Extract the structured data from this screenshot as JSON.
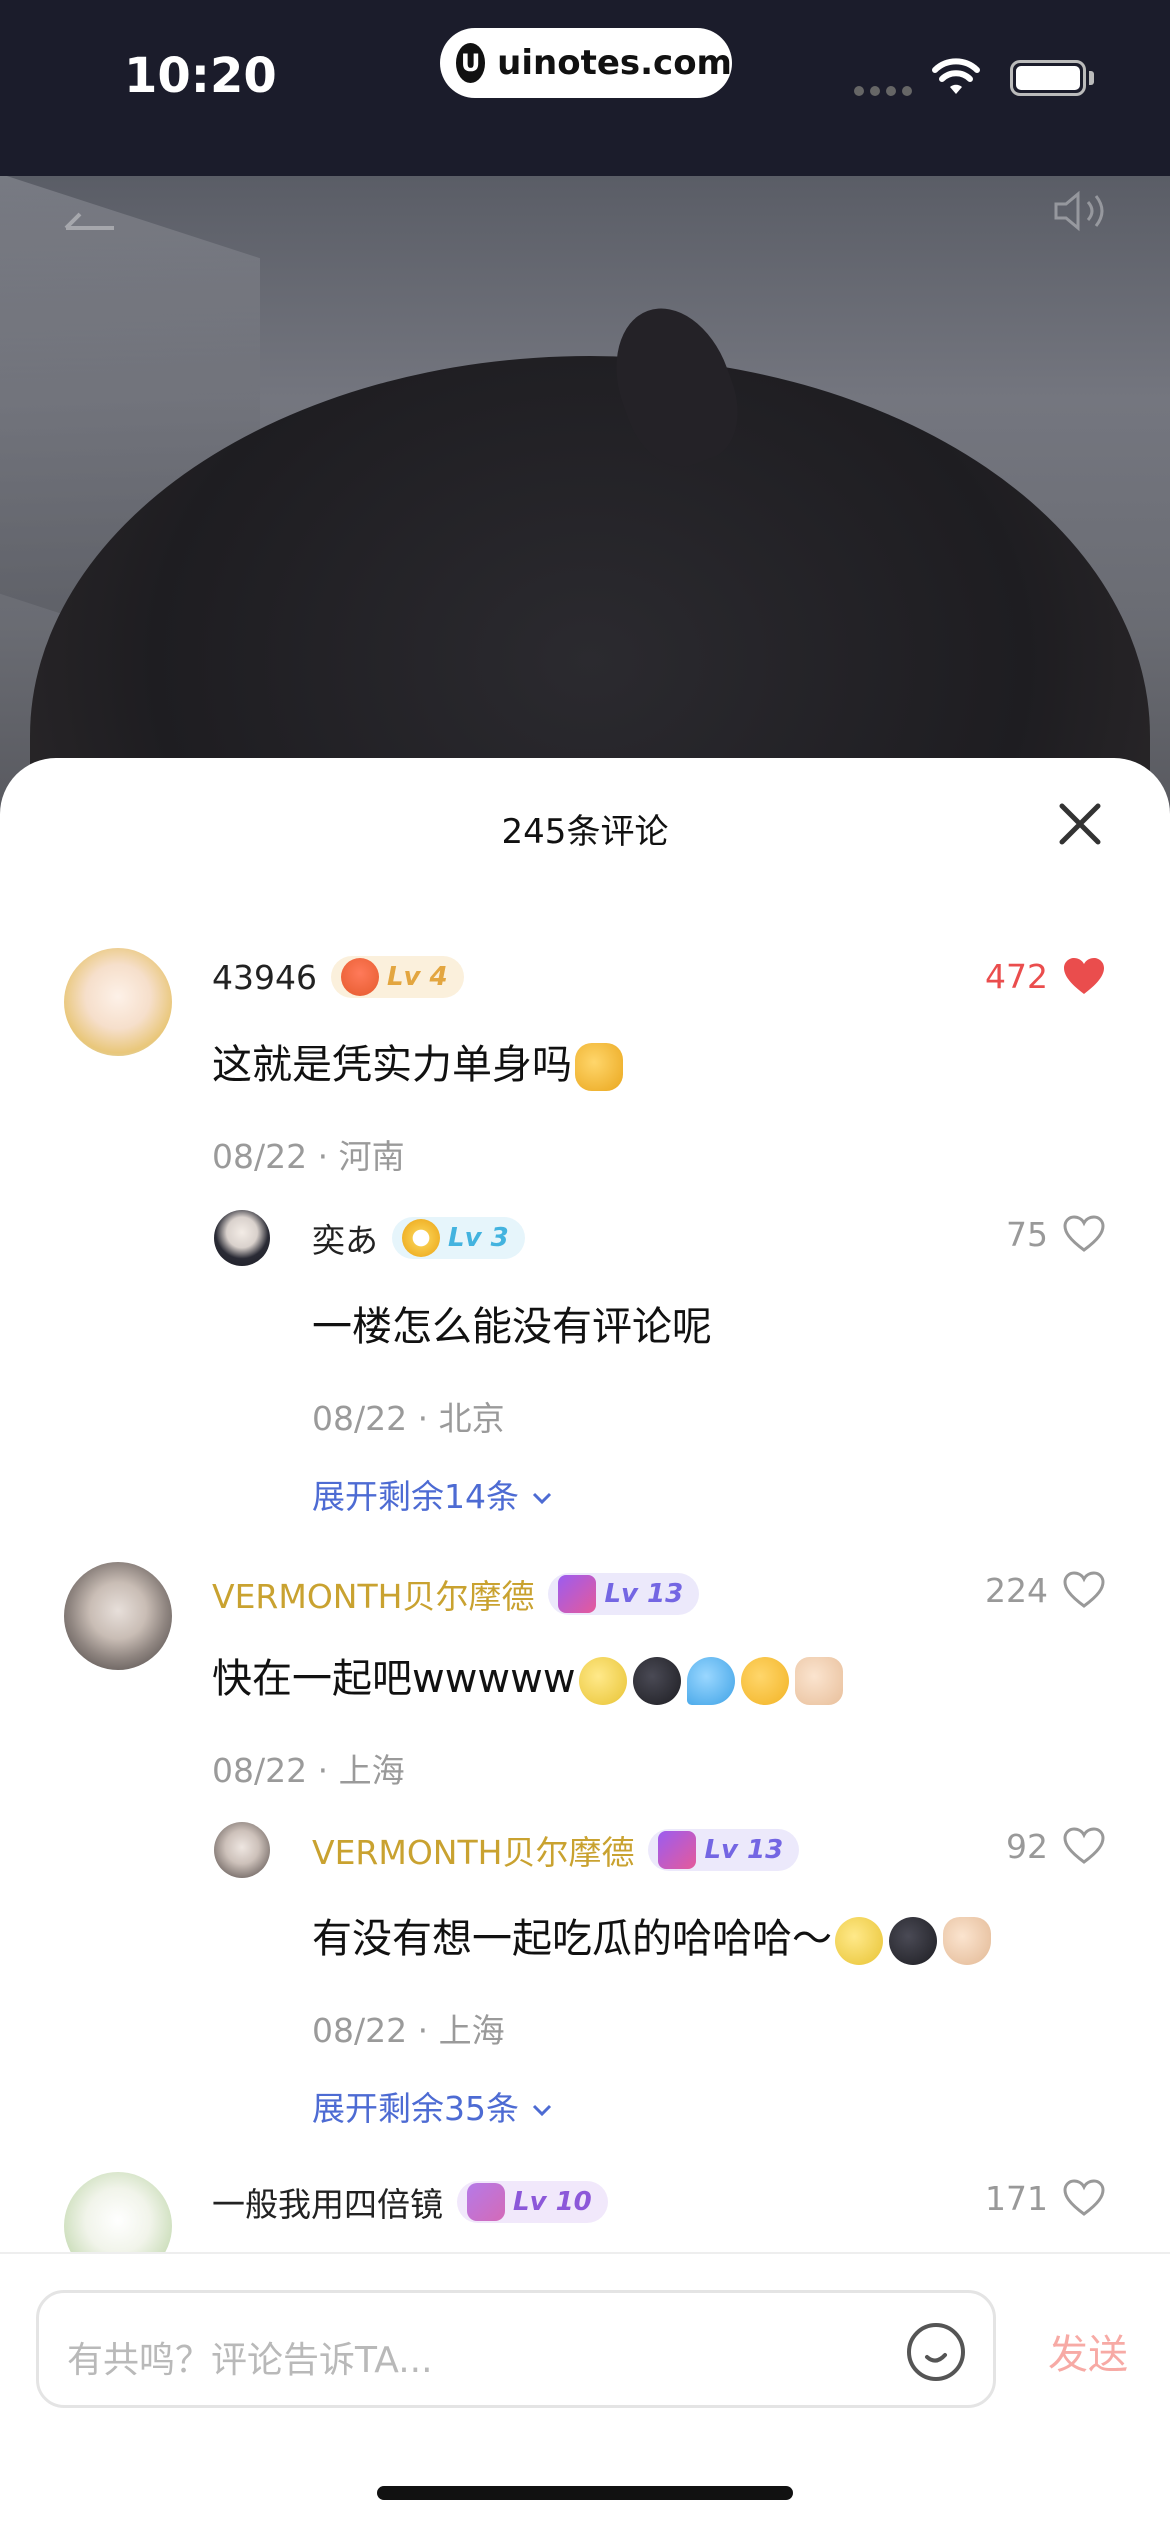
{
  "status_bar": {
    "time": "10:20",
    "url": "uinotes.com",
    "logo_letter": "U"
  },
  "sheet": {
    "title": "245条评论"
  },
  "comments": [
    {
      "username": "43946",
      "level": "Lv 4",
      "text": "这就是凭实力单身吗",
      "meta": "08/22 · 河南",
      "likes": "472",
      "liked": true,
      "emojis": [
        "thumbs-up"
      ]
    },
    {
      "username": "奕あ",
      "level": "Lv 3",
      "text": "一楼怎么能没有评论呢",
      "meta": "08/22 · 北京",
      "likes": "75",
      "liked": false,
      "expand": "展开剩余14条"
    },
    {
      "username": "VERMONTH贝尔摩德",
      "level": "Lv 13",
      "text": "快在一起吧wwwww",
      "meta": "08/22 · 上海",
      "likes": "224",
      "liked": false,
      "emojis": [
        "full-moon-face",
        "new-moon-face",
        "sweat-droplets",
        "crying-face",
        "fist"
      ]
    },
    {
      "username": "VERMONTH贝尔摩德",
      "level": "Lv 13",
      "text": "有没有想一起吃瓜的哈哈哈～",
      "meta": "08/22 · 上海",
      "likes": "92",
      "liked": false,
      "expand": "展开剩余35条",
      "emojis": [
        "full-moon-face",
        "new-moon-face",
        "victory-hand"
      ]
    },
    {
      "username": "一般我用四倍镜",
      "level": "Lv 10",
      "likes": "171",
      "liked": false
    }
  ],
  "input": {
    "placeholder": "有共鸣？评论告诉TA...",
    "send_label": "发送"
  },
  "colors": {
    "liked_red": "#ea4d4d",
    "link_blue": "#4d6bd3",
    "gold_name": "#c9a230",
    "send_disabled": "#f7aaa5"
  }
}
